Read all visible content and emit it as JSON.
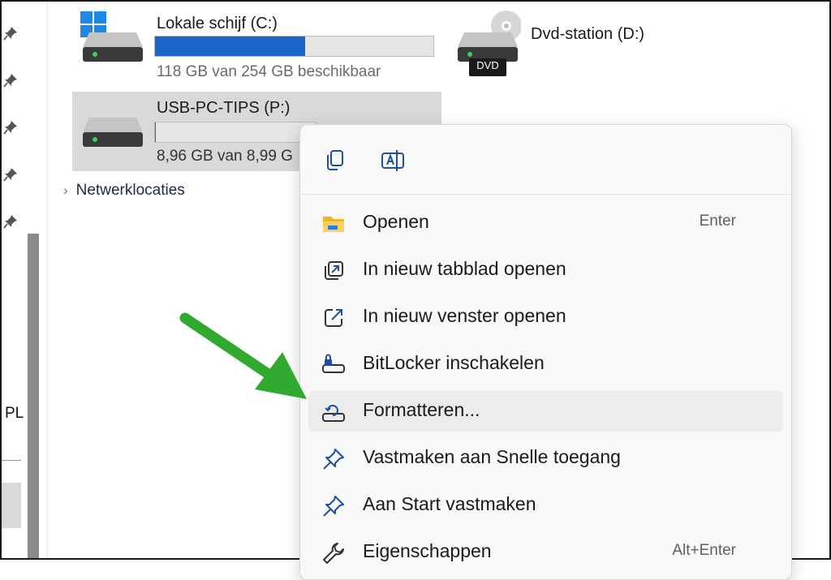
{
  "drives": [
    {
      "name": "Lokale schijf (C:)",
      "info": "118 GB van 254 GB beschikbaar",
      "used_fraction": 0.54
    },
    {
      "name": "Dvd-station (D:)",
      "badge": "DVD"
    },
    {
      "name": "USB-PC-TIPS (P:)",
      "info": "8,96 GB van 8,99 G",
      "used_fraction": 0.003
    }
  ],
  "nav": {
    "partial_label": "PL",
    "pins": [
      "pin-icon",
      "pin-icon",
      "pin-icon",
      "pin-icon",
      "pin-icon"
    ]
  },
  "network": {
    "label": "Netwerklocaties"
  },
  "context_menu": {
    "top_actions": [
      "copy-icon",
      "rename-icon"
    ],
    "items": [
      {
        "label": "Openen",
        "shortcut": "Enter",
        "icon": "folder-icon"
      },
      {
        "label": "In nieuw tabblad openen",
        "shortcut": "",
        "icon": "new-tab-icon"
      },
      {
        "label": "In nieuw venster openen",
        "shortcut": "",
        "icon": "new-window-icon"
      },
      {
        "label": "BitLocker inschakelen",
        "shortcut": "",
        "icon": "bitlocker-icon"
      },
      {
        "label": "Formatteren...",
        "shortcut": "",
        "icon": "format-icon",
        "highlighted": true
      },
      {
        "label": "Vastmaken aan Snelle toegang",
        "shortcut": "",
        "icon": "pin-icon"
      },
      {
        "label": "Aan Start vastmaken",
        "shortcut": "",
        "icon": "pin-icon"
      },
      {
        "label": "Eigenschappen",
        "shortcut": "Alt+Enter",
        "icon": "wrench-icon"
      }
    ]
  },
  "colors": {
    "accent": "#1a66c9",
    "selection": "#d9d9d9",
    "annotation_arrow": "#2faa2f"
  }
}
